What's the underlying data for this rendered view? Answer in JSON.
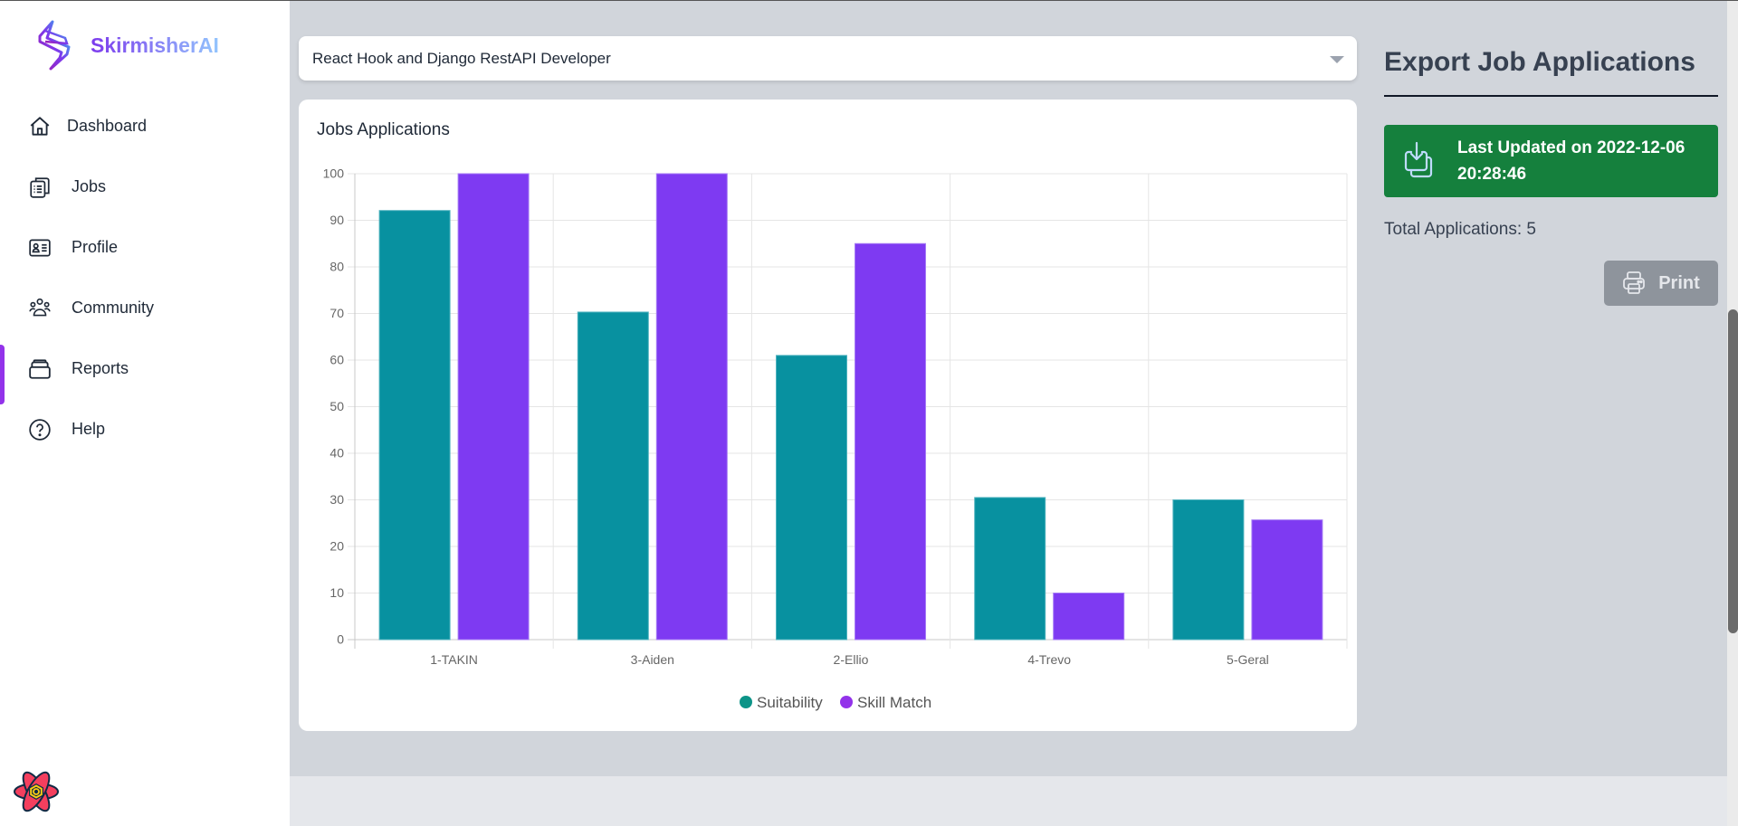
{
  "app": {
    "brand_name": "SkirmisherAI"
  },
  "sidebar": {
    "items": [
      {
        "label": "Dashboard",
        "icon": "home-icon",
        "active": false
      },
      {
        "label": "Jobs",
        "icon": "clipboard-list-icon",
        "active": false
      },
      {
        "label": "Profile",
        "icon": "id-card-icon",
        "active": false
      },
      {
        "label": "Community",
        "icon": "users-group-icon",
        "active": false
      },
      {
        "label": "Reports",
        "icon": "archive-box-icon",
        "active": true
      },
      {
        "label": "Help",
        "icon": "question-circle-icon",
        "active": false
      }
    ],
    "footer_icon": "react-atom-icon"
  },
  "job_select": {
    "selected": "React Hook and Django RestAPI Developer"
  },
  "chart_card": {
    "title": "Jobs Applications"
  },
  "export_panel": {
    "title": "Export Job Applications",
    "last_updated": "Last Updated on 2022-12-06 20:28:46",
    "total_applications": "Total Applications: 5",
    "print_label": "Print"
  },
  "colors": {
    "suitability": "#0891a0",
    "skill_match": "#7e3af2",
    "accent": "#9333ea",
    "success": "#15803d"
  },
  "chart_data": {
    "type": "bar",
    "title": "Jobs Applications",
    "xlabel": "",
    "ylabel": "",
    "categories": [
      "1-TAKIN",
      "3-Aiden",
      "2-Ellio",
      "4-Trevo",
      "5-Geral"
    ],
    "series": [
      {
        "name": "Suitability",
        "color": "#0891a0",
        "values": [
          92.1,
          70.3,
          61.0,
          30.5,
          30.0
        ]
      },
      {
        "name": "Skill Match",
        "color": "#7e3af2",
        "values": [
          100,
          100,
          85,
          10,
          25.7
        ]
      }
    ],
    "ylim": [
      0,
      100
    ],
    "yticks": [
      0,
      10,
      20,
      30,
      40,
      50,
      60,
      70,
      80,
      90,
      100
    ],
    "grid": true,
    "legend_position": "bottom"
  }
}
